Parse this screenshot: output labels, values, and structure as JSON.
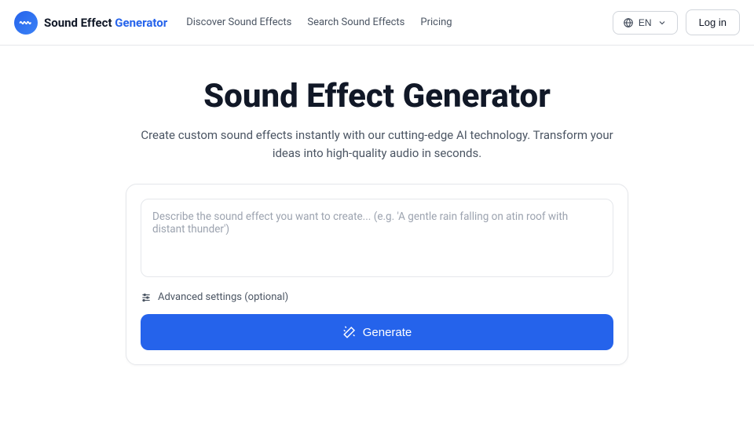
{
  "header": {
    "logo": {
      "text_part1": "Sound Effect ",
      "text_part2": "Generator"
    },
    "nav": {
      "discover": "Discover Sound Effects",
      "search": "Search Sound Effects",
      "pricing": "Pricing"
    },
    "lang": {
      "code": "EN"
    },
    "login": "Log in"
  },
  "hero": {
    "title": "Sound Effect Generator",
    "subtitle": "Create custom sound effects instantly with our cutting-edge AI technology. Transform your ideas into high-quality audio in seconds."
  },
  "card": {
    "prompt_placeholder": "Describe the sound effect you want to create... (e.g. 'A gentle rain falling on atin roof with distant thunder')",
    "advanced_label": "Advanced settings (optional)",
    "generate_label": "Generate"
  },
  "colors": {
    "accent": "#2563eb",
    "text_primary": "#111827",
    "text_secondary": "#4b5563",
    "border": "#e5e7eb",
    "placeholder": "#9ca3af"
  }
}
